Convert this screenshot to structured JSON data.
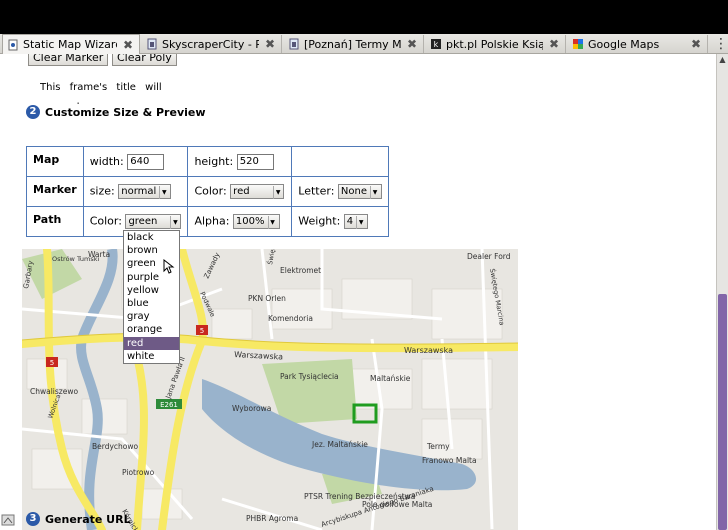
{
  "browser": {
    "tabs": [
      {
        "label": "Static Map Wizard",
        "icon": "page-icon",
        "active": true
      },
      {
        "label": "SkyscraperCity - R...",
        "icon": "page-icon",
        "active": false
      },
      {
        "label": "[Poznań] Termy M...",
        "icon": "page-icon",
        "active": false
      },
      {
        "label": "pkt.pl Polskie Ksią...",
        "icon": "pkt-icon",
        "active": false
      },
      {
        "label": "Google Maps",
        "icon": "google-icon",
        "active": false
      }
    ],
    "close_glyph": "✖",
    "tabs_menu_glyph": "⋮"
  },
  "buttons": {
    "clear_marker": "Clear Marker",
    "clear_poly": "Clear Poly"
  },
  "frame_note": "This frame's title will come here",
  "steps": {
    "customize": {
      "number": "2",
      "label": "Customize Size & Preview"
    },
    "generate": {
      "number": "3",
      "label": "Generate URL"
    }
  },
  "options": {
    "map": {
      "heading": "Map",
      "width_label": "width:",
      "width_value": "640",
      "height_label": "height:",
      "height_value": "520"
    },
    "marker": {
      "heading": "Marker",
      "size_label": "size:",
      "size_value": "normal",
      "color_label": "Color:",
      "color_value": "red",
      "letter_label": "Letter:",
      "letter_value": "None"
    },
    "path": {
      "heading": "Path",
      "color_label": "Color:",
      "color_value": "green",
      "alpha_label": "Alpha:",
      "alpha_value": "100%",
      "weight_label": "Weight:",
      "weight_value": "4"
    }
  },
  "color_dropdown": {
    "options": [
      "black",
      "brown",
      "green",
      "purple",
      "yellow",
      "blue",
      "gray",
      "orange",
      "red",
      "white"
    ],
    "highlighted": "red"
  },
  "map_labels": {
    "warta": "Warta",
    "ostrow_tumski": "Ostrów Tumski",
    "elektromet": "Elektromet",
    "dealer_ford": "Dealer Ford",
    "zawady": "Zawady",
    "garbary": "Garbary",
    "swietego_michala": "Świętego Michała",
    "pkn_orlen": "PKN Orlen",
    "komendoria": "Komendoria",
    "warszawska_1": "Warszawska",
    "warszawska_2": "Warszawska",
    "sw_marcin": "Świętego Marcina",
    "chwaliszewo": "Chwaliszewo",
    "park": "Park Tysiąclecia",
    "maltanskie": "Maltańskie",
    "wyborowa": "Wyborowa",
    "e261": "E261",
    "road5_a": "5",
    "road5_b": "5",
    "berdychowo": "Berdychowo",
    "jez": "Jez. Maltańskie",
    "termy": "Termy",
    "franowo": "Franowo Malta",
    "piotrowo": "Piotrowo",
    "ptsr": "PTSR Trening Bezpieczeństwa",
    "arcybiskupa": "Arcybiskupa Antoniego Baraniaka",
    "pole": "Pole golfowe Malta",
    "phbr": "PHBR Agroma",
    "kornicka": "Kórnicka",
    "jana_pawla": "Jana Pawła II",
    "wolnica": "Wolnica",
    "mostowa": "Mostowa",
    "garbary2": "Garbary",
    "podwale": "Podwale"
  },
  "colors": {
    "accent": "#2c5aa8",
    "table_border": "#4f79b8",
    "dropdown_highlight": "#6e5a86",
    "scrollbar_thumb": "#8266a8",
    "road_yellow": "#f7e964",
    "road_white": "#ffffff",
    "water": "#99b3cc",
    "park_green": "#c2d8a6",
    "map_bg": "#e8e6e1",
    "marker_green": "#1f9c1f"
  }
}
